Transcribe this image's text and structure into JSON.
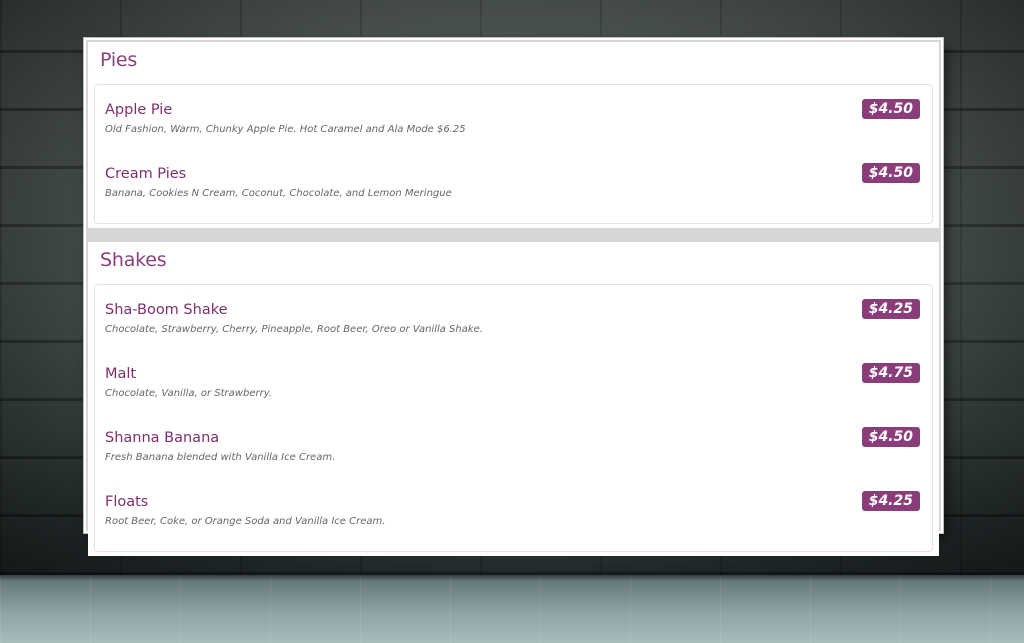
{
  "sections": [
    {
      "title": "Pies",
      "items": [
        {
          "name": "Apple Pie",
          "description": "Old Fashion, Warm, Chunky Apple Pie. Hot Caramel and Ala Mode  $6.25",
          "price": "$4.50"
        },
        {
          "name": "Cream Pies",
          "description": "Banana, Cookies N Cream, Coconut, Chocolate, and Lemon Meringue",
          "price": "$4.50"
        }
      ]
    },
    {
      "title": "Shakes",
      "items": [
        {
          "name": "Sha-Boom Shake",
          "description": "Chocolate, Strawberry, Cherry, Pineapple, Root Beer, Oreo or Vanilla Shake.",
          "price": "$4.25"
        },
        {
          "name": "Malt",
          "description": "Chocolate, Vanilla, or Strawberry.",
          "price": "$4.75"
        },
        {
          "name": "Shanna Banana",
          "description": "Fresh Banana blended with Vanilla Ice Cream.",
          "price": "$4.50"
        },
        {
          "name": "Floats",
          "description": "Root Beer, Coke, or Orange Soda and Vanilla Ice Cream.",
          "price": "$4.25"
        }
      ]
    }
  ],
  "colors": {
    "accent": "#8a3c7b",
    "item_name": "#7e2f6e",
    "description": "#666666"
  }
}
